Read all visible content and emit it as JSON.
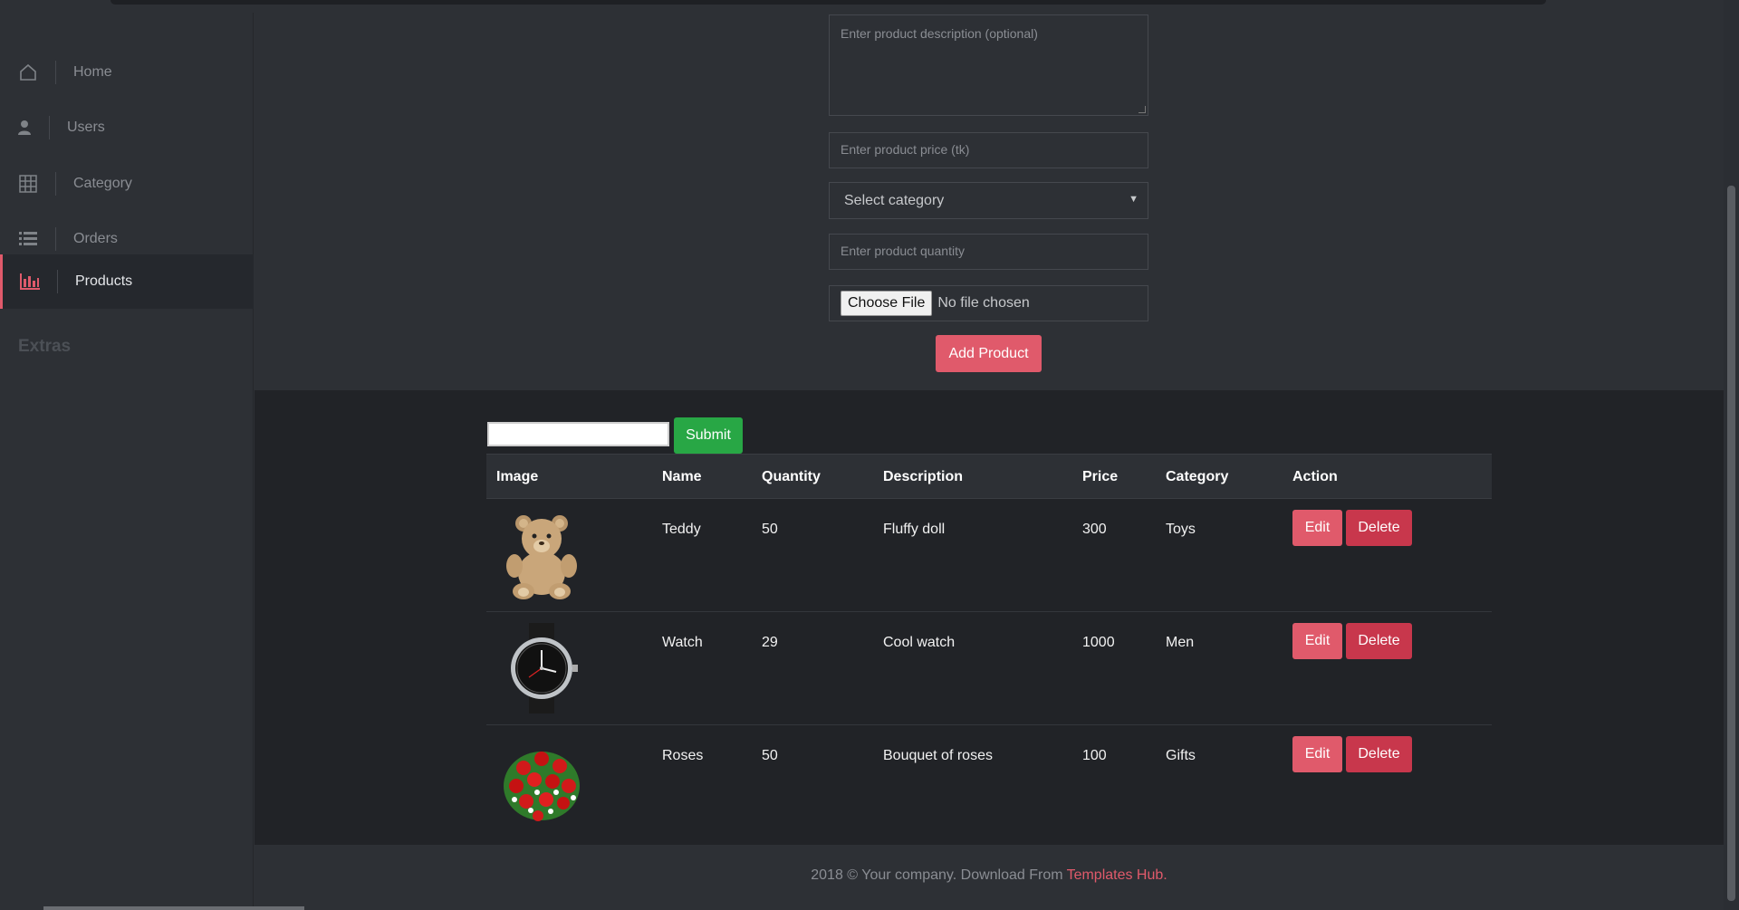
{
  "sidebar": {
    "items": [
      {
        "label": "Home",
        "icon": "home-icon"
      },
      {
        "label": "Users",
        "icon": "user-icon"
      },
      {
        "label": "Category",
        "icon": "grid-icon"
      },
      {
        "label": "Orders",
        "icon": "list-icon"
      },
      {
        "label": "Products",
        "icon": "bar-chart-icon",
        "active": true
      }
    ],
    "heading": "Extras"
  },
  "form": {
    "description_placeholder": "Enter product description (optional)",
    "price_placeholder": "Enter product price (tk)",
    "category_selected": "Select category",
    "quantity_placeholder": "Enter product quantity",
    "file_button": "Choose File",
    "file_status": "No file chosen",
    "add_button": "Add Product"
  },
  "search": {
    "value": "",
    "submit_label": "Submit"
  },
  "table": {
    "headers": [
      "Image",
      "Name",
      "Quantity",
      "Description",
      "Price",
      "Category",
      "Action"
    ],
    "rows": [
      {
        "image": "teddy-bear",
        "name": "Teddy",
        "quantity": "50",
        "description": "Fluffy doll",
        "price": "300",
        "category": "Toys"
      },
      {
        "image": "watch",
        "name": "Watch",
        "quantity": "29",
        "description": "Cool watch",
        "price": "1000",
        "category": "Men"
      },
      {
        "image": "roses",
        "name": "Roses",
        "quantity": "50",
        "description": "Bouquet of roses",
        "price": "100",
        "category": "Gifts"
      }
    ],
    "edit_label": "Edit",
    "delete_label": "Delete"
  },
  "footer": {
    "text": "2018 © Your company. Download From",
    "link": "Templates Hub."
  },
  "colors": {
    "accent": "#e05a6b",
    "delete": "#c8374c",
    "submit": "#28a745",
    "background": "#2d3035",
    "table_bg": "#212327"
  }
}
